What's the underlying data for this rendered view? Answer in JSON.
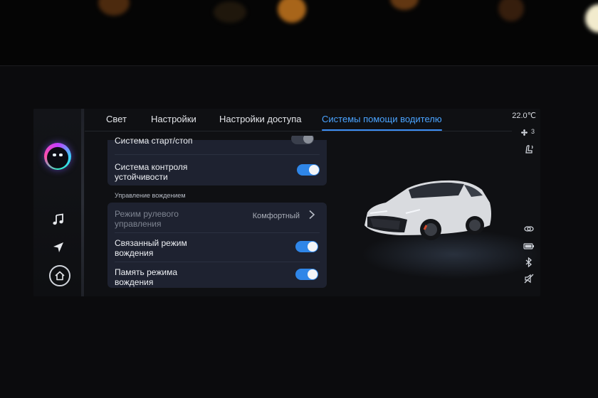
{
  "tabs": [
    {
      "label": "Свет",
      "active": false
    },
    {
      "label": "Настройки",
      "active": false
    },
    {
      "label": "Настройки доступа",
      "active": false
    },
    {
      "label": "Системы помощи водителю",
      "active": true
    }
  ],
  "status": {
    "temperature": "22.0℃",
    "fan_level": "3"
  },
  "rail": {
    "icons": [
      "assistant-avatar-icon",
      "music-icon",
      "navigation-icon",
      "home-icon"
    ]
  },
  "settings": {
    "top_rows": [
      {
        "label": "Система старт/стоп",
        "toggle": "on",
        "partially_visible": true
      },
      {
        "label_line1": "Система контроля",
        "label_line2": "устойчивости",
        "toggle": "on"
      }
    ],
    "section_title": "Управление вождением",
    "driving_rows": [
      {
        "label_line1": "Режим рулевого",
        "label_line2": "управления",
        "value": "Комфортный",
        "disabled": true
      },
      {
        "label_line1": "Связанный режим",
        "label_line2": "вождения",
        "toggle": "on"
      },
      {
        "label_line1": "Память режима",
        "label_line2": "вождения",
        "toggle": "on"
      }
    ]
  },
  "colors": {
    "accent": "#3d8ff5",
    "card": "#1e2230",
    "toggle_on": "#2f86e8"
  }
}
